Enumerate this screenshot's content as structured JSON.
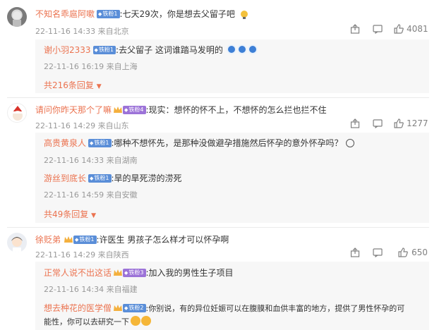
{
  "comments": [
    {
      "user": "不知名乖扈阿嗽",
      "badge": "铁粉1",
      "text": ":七天29次，你是想去父留子吧",
      "time": "22-11-16 14:33",
      "location": "来自北京",
      "likes": "4081",
      "replies": [
        {
          "user": "谢小羽2333",
          "badge": "铁粉1",
          "text": ":去父留子  这词谁踏马发明的",
          "time": "22-11-16 16:19",
          "location": "来自上海"
        }
      ],
      "more": "共216条回复"
    },
    {
      "user": "请问你昨天那个了嘛",
      "badge": "铁粉4",
      "text": ":现实：想怀的怀不上，不想怀的怎么拦也拦不住",
      "time": "22-11-16 14:29",
      "location": "来自山东",
      "likes": "1277",
      "replies": [
        {
          "user": "高贵黄泉人",
          "badge": "铁粉1",
          "text": ":哪种不想怀先，是那种没做避孕措施然后怀孕的意外怀孕吗？",
          "time": "22-11-16 14:33",
          "location": "来自湖南"
        },
        {
          "user": "游丝到底长",
          "badge": "铁粉1",
          "text": ":旱的旱死涝的涝死",
          "time": "22-11-16 14:59",
          "location": "来自安徽"
        }
      ],
      "more": "共49条回复"
    },
    {
      "user": "徐贬弟",
      "badge": "铁粉1",
      "text": ":许医生 男孩子怎么样才可以怀孕啊",
      "time": "22-11-16 14:29",
      "location": "来自陕西",
      "likes": "650",
      "replies": [
        {
          "user": "正常人说不出这话",
          "badge": "铁粉3",
          "text": ":加入我的男性生子项目",
          "time": "22-11-16 14:34",
          "location": "来自福建"
        },
        {
          "user": "想去种花的医学僧",
          "badge": "铁粉2",
          "text": ":你别说，有的异位妊娠可以在腹膜和血供丰富的地方，提供了男性怀孕的可",
          "text2": "能性，你可以去研究一下"
        }
      ]
    }
  ],
  "icons": {
    "share": "share-icon",
    "comment": "comment-icon",
    "like": "thumbs-up-icon"
  },
  "colors": {
    "username": "#eb7350",
    "badge_blue": "#5a8ed8",
    "badge_purple": "#9c73d8",
    "meta": "#999999",
    "reply_bg": "#f7f7f7"
  }
}
